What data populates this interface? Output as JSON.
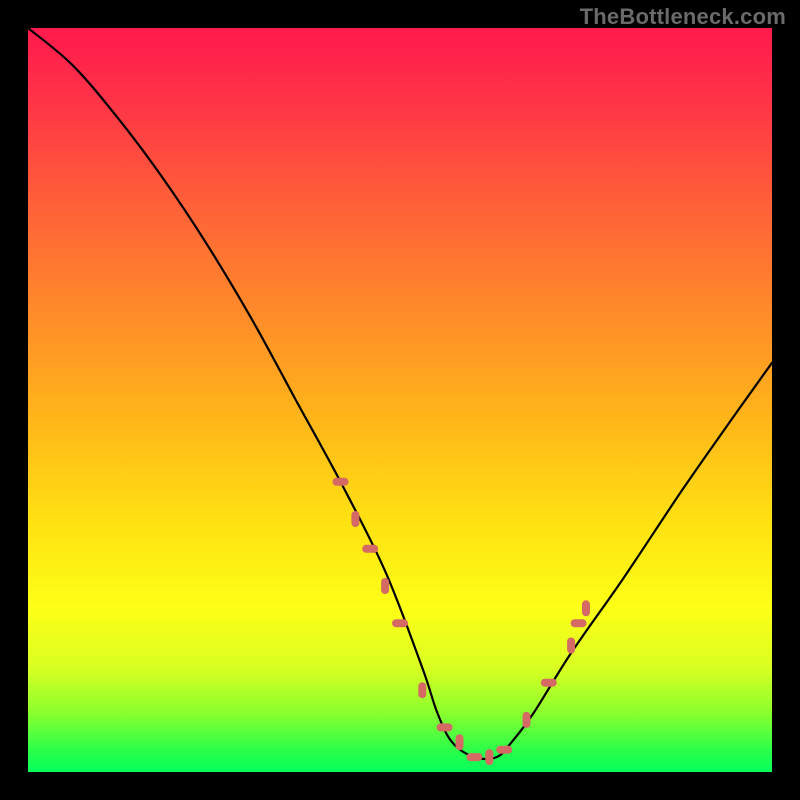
{
  "watermark": "TheBottleneck.com",
  "chart_data": {
    "type": "line",
    "title": "",
    "xlabel": "",
    "ylabel": "",
    "xlim": [
      0,
      100
    ],
    "ylim": [
      0,
      100
    ],
    "series": [
      {
        "name": "bottleneck-curve",
        "x": [
          0,
          6,
          12,
          18,
          24,
          30,
          36,
          42,
          48,
          53,
          55,
          57,
          60,
          63,
          65,
          68,
          73,
          80,
          88,
          95,
          100
        ],
        "values": [
          100,
          95,
          88,
          80,
          71,
          61,
          50,
          39,
          27,
          14,
          8,
          4,
          2,
          2,
          4,
          8,
          16,
          26,
          38,
          48,
          55
        ]
      }
    ],
    "markers": {
      "name": "highlight-dots",
      "color": "#d46a63",
      "x": [
        42,
        44,
        46,
        48,
        50,
        53,
        56,
        58,
        60,
        62,
        64,
        67,
        70,
        73,
        74,
        75
      ],
      "values": [
        39,
        34,
        30,
        25,
        20,
        11,
        6,
        4,
        2,
        2,
        3,
        7,
        12,
        17,
        20,
        22
      ]
    }
  }
}
